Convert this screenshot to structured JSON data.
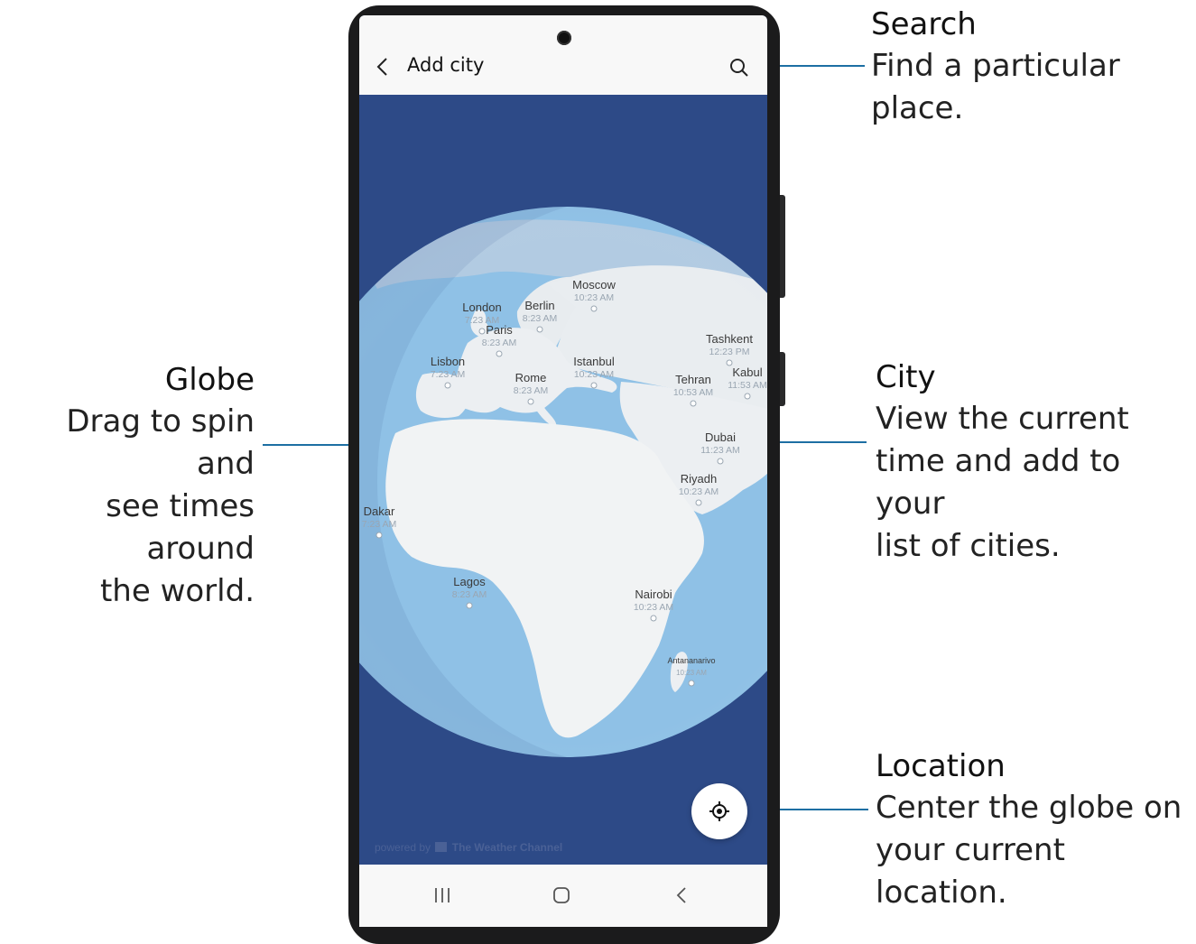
{
  "callouts": {
    "search": {
      "title": "Search",
      "desc": [
        "Find a particular",
        "place."
      ]
    },
    "globe": {
      "title": "Globe",
      "desc": [
        "Drag to spin and",
        "see times around",
        "the world."
      ]
    },
    "city": {
      "title": "City",
      "desc": [
        "View the current",
        "time and add to your",
        "list of cities."
      ]
    },
    "location": {
      "title": "Location",
      "desc": [
        "Center the globe on",
        "your current location."
      ]
    }
  },
  "app": {
    "title": "Add city",
    "icons": {
      "back": "back-arrow-icon",
      "search": "search-icon",
      "location": "my-location-icon"
    }
  },
  "cities": [
    {
      "name": "Moscow",
      "time": "10:23 AM"
    },
    {
      "name": "London",
      "time": "7:23 AM"
    },
    {
      "name": "Berlin",
      "time": "8:23 AM"
    },
    {
      "name": "Paris",
      "time": "8:23 AM"
    },
    {
      "name": "Lisbon",
      "time": "7:23 AM"
    },
    {
      "name": "Istanbul",
      "time": "10:23 AM"
    },
    {
      "name": "Rome",
      "time": "8:23 AM"
    },
    {
      "name": "Tashkent",
      "time": "12:23 PM"
    },
    {
      "name": "Tehran",
      "time": "10:53 AM"
    },
    {
      "name": "Kabul",
      "time": "11:53 AM"
    },
    {
      "name": "Dubai",
      "time": "11:23 AM"
    },
    {
      "name": "Riyadh",
      "time": "10:23 AM"
    },
    {
      "name": "Dakar",
      "time": "7:23 AM"
    },
    {
      "name": "Lagos",
      "time": "8:23 AM"
    },
    {
      "name": "Nairobi",
      "time": "10:23 AM"
    },
    {
      "name": "Antananarivo",
      "time": "10:23 AM"
    }
  ],
  "footer": {
    "powered_by": "powered by",
    "brand": "The Weather Channel"
  },
  "colors": {
    "background": "#2d4a87",
    "ocean": "#8fc1e6",
    "land": "#f1f3f4",
    "accent_line": "#1d6fa3"
  }
}
